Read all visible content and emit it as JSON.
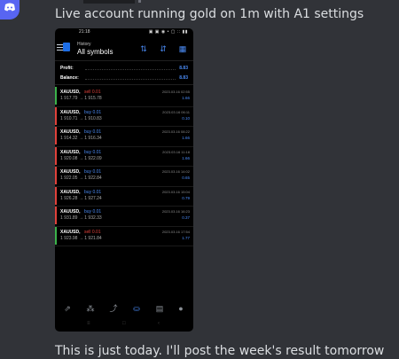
{
  "message": {
    "text_top": "Live account running gold on 1m with A1 settings",
    "text_bottom": "This is just today. I'll post the week's result tomorrow"
  },
  "phone": {
    "status_time": "21:18",
    "status_icons": "▣ ▣ ◉ • ▢ ∷ ▮▮",
    "header": {
      "small": "History",
      "title": "All symbols",
      "icons": [
        "sort-icon",
        "swap-icon",
        "calendar-icon"
      ]
    },
    "summary": [
      {
        "label": "Profit:",
        "value": "8.83"
      },
      {
        "label": "Balance:",
        "value": "8.83"
      }
    ],
    "trades": [
      {
        "symbol": "XAUUSD,",
        "side": "sell 0.01",
        "side_color": "#e0413a",
        "bar_color": "#3bb34a",
        "prices": "1 917.79 → 1 915.78",
        "time": "2023.03.16 02:55",
        "profit": "1.66"
      },
      {
        "symbol": "XAUUSD,",
        "side": "buy 0.01",
        "side_color": "#4a8bf5",
        "bar_color": "#e0413a",
        "prices": "1 910.71 → 1 910.83",
        "time": "2023.03.16 06:11",
        "profit": "0.10"
      },
      {
        "symbol": "XAUUSD,",
        "side": "buy 0.01",
        "side_color": "#4a8bf5",
        "bar_color": "#e0413a",
        "prices": "1 914.32 → 1 916.34",
        "time": "2023.03.16 08:22",
        "profit": "1.66"
      },
      {
        "symbol": "XAUUSD,",
        "side": "buy 0.01",
        "side_color": "#4a8bf5",
        "bar_color": "#e0413a",
        "prices": "1 920.08 → 1 922.09",
        "time": "2023.03.16 11:18",
        "profit": "1.66"
      },
      {
        "symbol": "XAUUSD,",
        "side": "buy 0.01",
        "side_color": "#4a8bf5",
        "bar_color": "#e0413a",
        "prices": "1 922.05 → 1 922.84",
        "time": "2023.03.16 14:02",
        "profit": "0.65"
      },
      {
        "symbol": "XAUUSD,",
        "side": "buy 0.01",
        "side_color": "#4a8bf5",
        "bar_color": "#e0413a",
        "prices": "1 926.28 → 1 927.24",
        "time": "2023.03.16 15:04",
        "profit": "0.79"
      },
      {
        "symbol": "XAUUSD,",
        "side": "buy 0.01",
        "side_color": "#4a8bf5",
        "bar_color": "#e0413a",
        "prices": "1 931.89 → 1 932.33",
        "time": "2023.03.16 16:23",
        "profit": "0.37"
      },
      {
        "symbol": "XAUUSD,",
        "side": "sell 0.01",
        "side_color": "#e0413a",
        "bar_color": "#3bb34a",
        "prices": "1 923.98 → 1 921.84",
        "time": "2023.03.16 17:54",
        "profit": "1.77"
      }
    ],
    "bottom_nav": [
      "quotes-icon",
      "signals-icon",
      "chart-icon",
      "history-icon",
      "news-icon",
      "chat-icon"
    ],
    "system_nav": [
      "≡",
      "□",
      "‹"
    ]
  },
  "colors": {
    "discord_bg": "#313338",
    "accent_blue": "#4a8bf5",
    "loss_red": "#e0413a",
    "profit_green": "#3bb34a"
  }
}
